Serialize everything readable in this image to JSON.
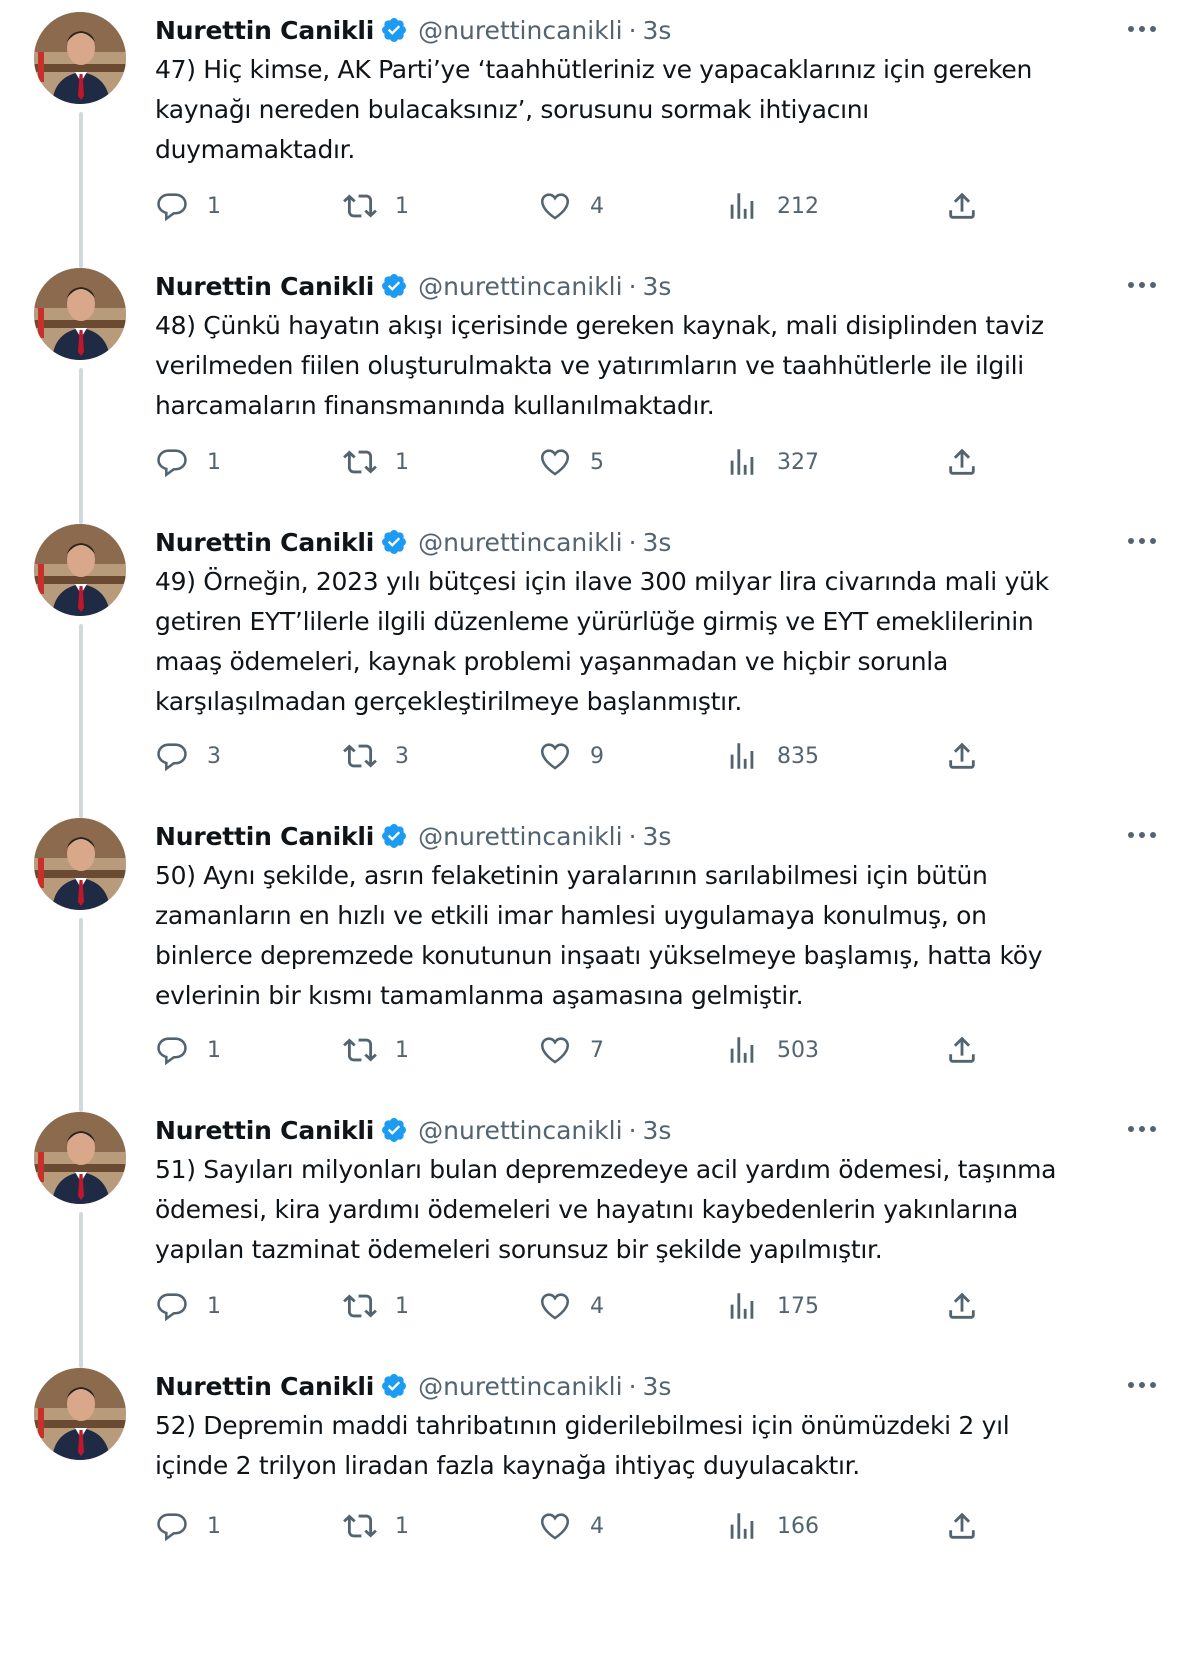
{
  "author": {
    "name": "Nurettin Canikli",
    "handle": "@nurettincanikli",
    "separator": "·",
    "time": "3s"
  },
  "colors": {
    "verified": "#1d9bf0",
    "text": "#0f1419",
    "muted": "#536471",
    "thread_line": "#cfd9de"
  },
  "icons": {
    "reply": "reply-icon",
    "retweet": "retweet-icon",
    "like": "heart-icon",
    "views": "views-icon",
    "share": "share-icon",
    "more": "more-icon",
    "verified": "verified-badge-icon"
  },
  "tweets": [
    {
      "text": "47) Hiç kimse, AK Parti’ye ‘taahhütleriniz ve yapacaklarınız için gereken\nkaynağı nereden bulacaksınız’, sorusunu sormak ihtiyacını\nduymamaktadır.",
      "replies": "1",
      "retweets": "1",
      "likes": "4",
      "views": "212"
    },
    {
      "text": "48) Çünkü hayatın akışı içerisinde gereken kaynak, mali disiplinden taviz\nverilmeden fiilen oluşturulmakta ve yatırımların ve taahhütlerle ile ilgili\nharcamaların finansmanında kullanılmaktadır.",
      "replies": "1",
      "retweets": "1",
      "likes": "5",
      "views": "327"
    },
    {
      "text": "49) Örneğin, 2023 yılı bütçesi için ilave 300 milyar lira civarında mali yük\ngetiren EYT’lilerle ilgili düzenleme yürürlüğe girmiş ve EYT emeklilerinin\nmaaş ödemeleri, kaynak problemi yaşanmadan ve hiçbir sorunla\nkarşılaşılmadan gerçekleştirilmeye başlanmıştır.",
      "replies": "3",
      "retweets": "3",
      "likes": "9",
      "views": "835"
    },
    {
      "text": "50) Aynı şekilde, asrın felaketinin yaralarının sarılabilmesi için bütün\nzamanların en hızlı ve etkili imar hamlesi uygulamaya konulmuş, on\nbinlerce depremzede konutunun inşaatı yükselmeye başlamış, hatta köy\nevlerinin bir kısmı tamamlanma aşamasına gelmiştir.",
      "replies": "1",
      "retweets": "1",
      "likes": "7",
      "views": "503"
    },
    {
      "text": "51) Sayıları milyonları bulan depremzedeye acil yardım ödemesi, taşınma\nödemesi, kira yardımı ödemeleri ve hayatını kaybedenlerin yakınlarına\nyapılan tazminat ödemeleri sorunsuz bir şekilde yapılmıştır.",
      "replies": "1",
      "retweets": "1",
      "likes": "4",
      "views": "175"
    },
    {
      "text": "52) Depremin maddi tahribatının giderilebilmesi için önümüzdeki 2 yıl\niçinde 2 trilyon liradan fazla kaynağa ihtiyaç duyulacaktır.",
      "replies": "1",
      "retweets": "1",
      "likes": "4",
      "views": "166"
    }
  ]
}
